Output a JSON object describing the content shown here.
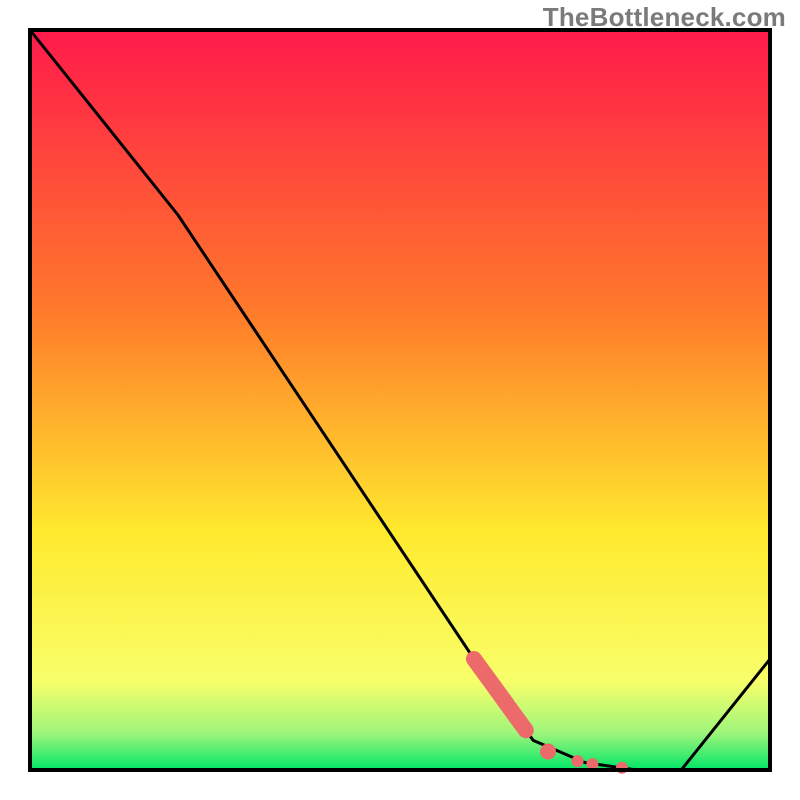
{
  "watermark": "TheBottleneck.com",
  "colors": {
    "gradient_top": "#ff1a4b",
    "gradient_mid1": "#ff7a2a",
    "gradient_mid2": "#ffea2e",
    "gradient_bottom_yellow": "#f8ff6a",
    "gradient_bottom_green": "#00e667",
    "curve_stroke": "#000000",
    "accent": "#ed6a6a",
    "frame": "#000000"
  },
  "chart_data": {
    "type": "line",
    "title": "",
    "xlabel": "",
    "ylabel": "",
    "xlim": [
      0,
      100
    ],
    "ylim": [
      0,
      100
    ],
    "series": [
      {
        "name": "curve",
        "x": [
          0,
          20,
          60,
          68,
          75,
          82,
          88,
          100
        ],
        "y": [
          100,
          75,
          15,
          4,
          1,
          0,
          0,
          15
        ]
      }
    ],
    "accent_segment": {
      "series": "curve",
      "x_start": 60,
      "x_end": 67
    },
    "accent_points": [
      {
        "x": 70,
        "y": 2.5
      },
      {
        "x": 74,
        "y": 1.2
      },
      {
        "x": 76,
        "y": 0.8
      },
      {
        "x": 80,
        "y": 0.3
      }
    ]
  }
}
